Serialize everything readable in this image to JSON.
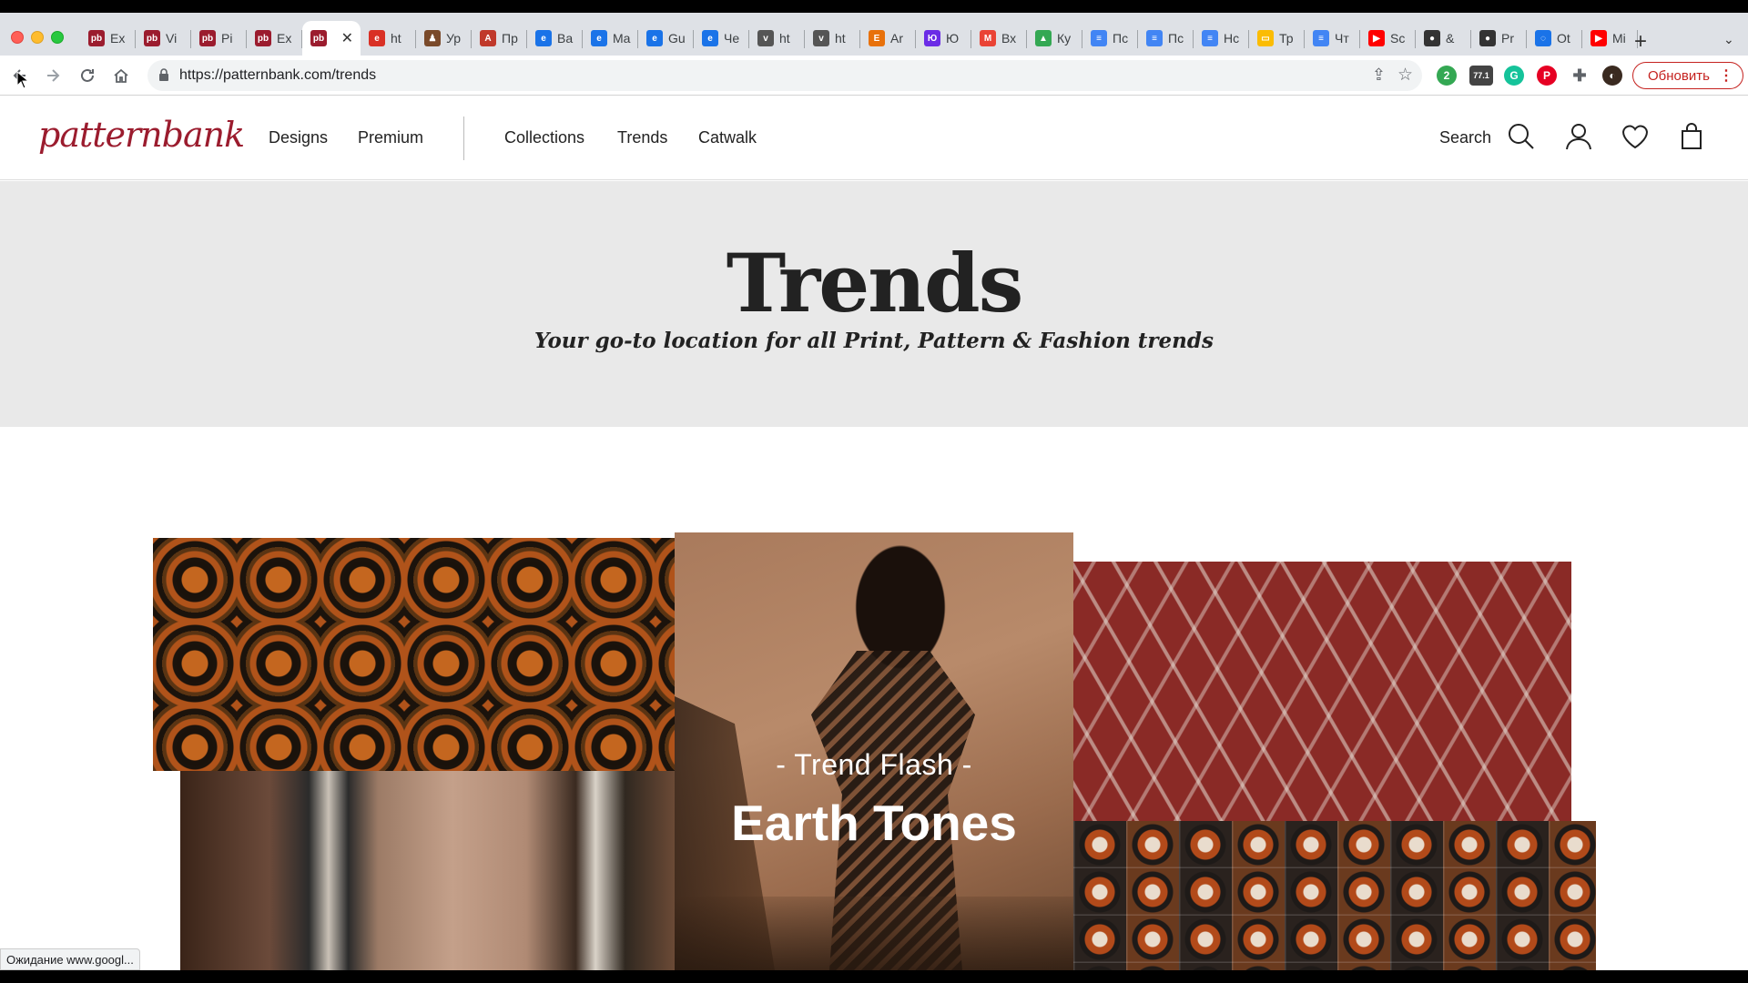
{
  "browser": {
    "tabs": [
      {
        "label": "Ex",
        "color": "#9b1c2e",
        "glyph": "pb"
      },
      {
        "label": "Vi",
        "color": "#9b1c2e",
        "glyph": "pb"
      },
      {
        "label": "Pi",
        "color": "#9b1c2e",
        "glyph": "pb"
      },
      {
        "label": "Ex",
        "color": "#9b1c2e",
        "glyph": "pb"
      },
      {
        "label": "",
        "color": "#9b1c2e",
        "glyph": "pb",
        "active": true
      },
      {
        "label": "ht",
        "color": "#d93025",
        "glyph": "e"
      },
      {
        "label": "Ур",
        "color": "#7a4a2a",
        "glyph": "♟"
      },
      {
        "label": "Пр",
        "color": "#c0392b",
        "glyph": "A"
      },
      {
        "label": "Ва",
        "color": "#1a73e8",
        "glyph": "e"
      },
      {
        "label": "Ma",
        "color": "#1a73e8",
        "glyph": "e"
      },
      {
        "label": "Gu",
        "color": "#1a73e8",
        "glyph": "e"
      },
      {
        "label": "Че",
        "color": "#1a73e8",
        "glyph": "e"
      },
      {
        "label": "ht",
        "color": "#555555",
        "glyph": "v"
      },
      {
        "label": "ht",
        "color": "#555555",
        "glyph": "v"
      },
      {
        "label": "Ar",
        "color": "#e8710a",
        "glyph": "E"
      },
      {
        "label": "Ю",
        "color": "#6b2ce6",
        "glyph": "Ю"
      },
      {
        "label": "Вх",
        "color": "#ea4335",
        "glyph": "M"
      },
      {
        "label": "Ку",
        "color": "#34a853",
        "glyph": "▲"
      },
      {
        "label": "Пс",
        "color": "#4285f4",
        "glyph": "≡"
      },
      {
        "label": "Пс",
        "color": "#4285f4",
        "glyph": "≡"
      },
      {
        "label": "Нс",
        "color": "#4285f4",
        "glyph": "≡"
      },
      {
        "label": "Тр",
        "color": "#fbbc04",
        "glyph": "▭"
      },
      {
        "label": "Чт",
        "color": "#4285f4",
        "glyph": "≡"
      },
      {
        "label": "Sc",
        "color": "#ff0000",
        "glyph": "▶"
      },
      {
        "label": "&",
        "color": "#333333",
        "glyph": "●"
      },
      {
        "label": "Pr",
        "color": "#333333",
        "glyph": "●"
      },
      {
        "label": "Ot",
        "color": "#1a73e8",
        "glyph": "◌"
      },
      {
        "label": "Mi",
        "color": "#ff0000",
        "glyph": "▶"
      }
    ],
    "new_tab_icon": "+",
    "tab_menu_icon": "⌄",
    "url": "https://patternbank.com/trends",
    "ext_badge_count": "2",
    "ext_badge_value": "77.1",
    "update_button": "Обновить",
    "status_text": "Ожидание www.googl..."
  },
  "site": {
    "logo": "patternbank",
    "nav": {
      "designs": "Designs",
      "premium": "Premium",
      "collections": "Collections",
      "trends": "Trends",
      "catwalk": "Catwalk"
    },
    "search_label": "Search",
    "accent_color": "#9b1c2e"
  },
  "hero": {
    "title": "Trends",
    "subtitle": "Your go-to location for all Print, Pattern & Fashion trends"
  },
  "feature": {
    "kicker": "- Trend Flash -",
    "title": "Earth Tones"
  }
}
